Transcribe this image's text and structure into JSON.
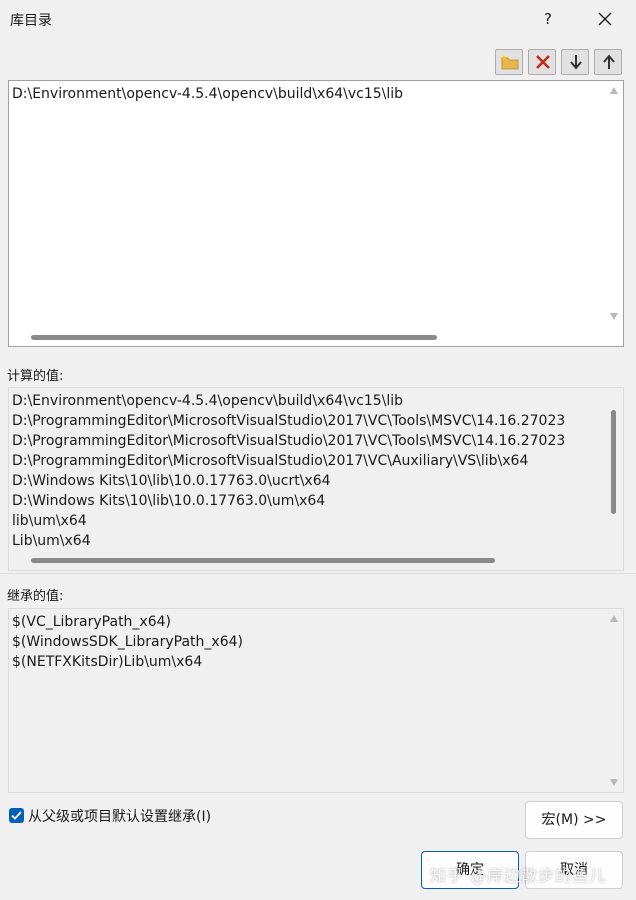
{
  "window": {
    "title": "库目录",
    "help_label": "?"
  },
  "editor": {
    "lines": [
      "D:\\Environment\\opencv-4.5.4\\opencv\\build\\x64\\vc15\\lib"
    ]
  },
  "computed": {
    "label": "计算的值:",
    "lines": [
      "D:\\Environment\\opencv-4.5.4\\opencv\\build\\x64\\vc15\\lib",
      "D:\\ProgrammingEditor\\MicrosoftVisualStudio\\2017\\VC\\Tools\\MSVC\\14.16.27023",
      "D:\\ProgrammingEditor\\MicrosoftVisualStudio\\2017\\VC\\Tools\\MSVC\\14.16.27023",
      "D:\\ProgrammingEditor\\MicrosoftVisualStudio\\2017\\VC\\Auxiliary\\VS\\lib\\x64",
      "D:\\Windows Kits\\10\\lib\\10.0.17763.0\\ucrt\\x64",
      "D:\\Windows Kits\\10\\lib\\10.0.17763.0\\um\\x64",
      "lib\\um\\x64",
      "Lib\\um\\x64"
    ]
  },
  "inherited": {
    "label": "继承的值:",
    "lines": [
      "$(VC_LibraryPath_x64)",
      "$(WindowsSDK_LibraryPath_x64)",
      "$(NETFXKitsDir)Lib\\um\\x64"
    ]
  },
  "inherit_checkbox": {
    "label": "从父级或项目默认设置继承(I)",
    "checked": true
  },
  "buttons": {
    "macros": "宏(M) >>",
    "ok": "确定",
    "cancel": "取消"
  },
  "watermark": "知乎 @岸边散步的鱼儿",
  "colors": {
    "accent": "#005fb8",
    "delete_icon": "#c42b1c",
    "new_folder_icon": "#e8b64c"
  }
}
